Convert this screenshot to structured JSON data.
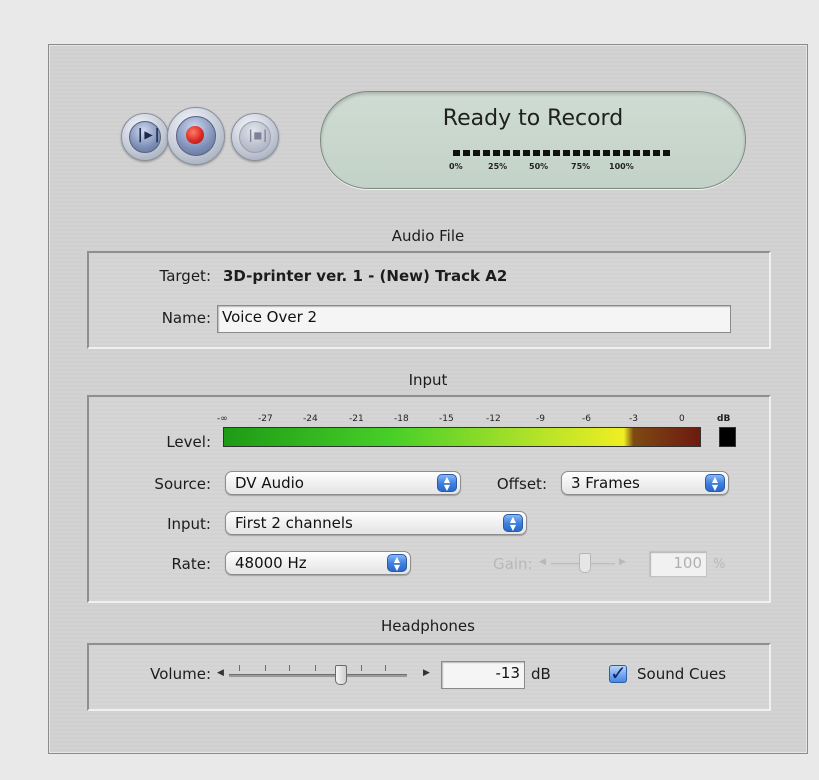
{
  "transport": {
    "play_icon": "play-in-out-icon",
    "record_icon": "record-icon",
    "stop_icon": "stop-icon"
  },
  "status": {
    "title": "Ready to Record",
    "progress_labels": [
      "0%",
      "25%",
      "50%",
      "75%",
      "100%"
    ],
    "progress_fraction": 1.0
  },
  "audio_file": {
    "section_title": "Audio File",
    "target_label": "Target:",
    "target_value": "3D-printer ver. 1 - (New) Track A2",
    "name_label": "Name:",
    "name_value": "Voice Over 2"
  },
  "input": {
    "section_title": "Input",
    "level_label": "Level:",
    "level_ticks": [
      "-∞",
      "-27",
      "-24",
      "-21",
      "-18",
      "-15",
      "-12",
      "-9",
      "-6",
      "-3",
      "0",
      "dB"
    ],
    "source_label": "Source:",
    "source_value": "DV Audio",
    "offset_label": "Offset:",
    "offset_value": "3 Frames",
    "input_label": "Input:",
    "input_value": "First 2 channels",
    "rate_label": "Rate:",
    "rate_value": "48000 Hz",
    "gain_label": "Gain:",
    "gain_value": "100",
    "gain_unit": "%"
  },
  "headphones": {
    "section_title": "Headphones",
    "volume_label": "Volume:",
    "volume_value": "-13",
    "volume_unit": "dB",
    "sound_cues_label": "Sound Cues",
    "sound_cues_checked": true
  },
  "colors": {
    "record": "#d92b22",
    "accent_blue": "#3f82e0"
  }
}
